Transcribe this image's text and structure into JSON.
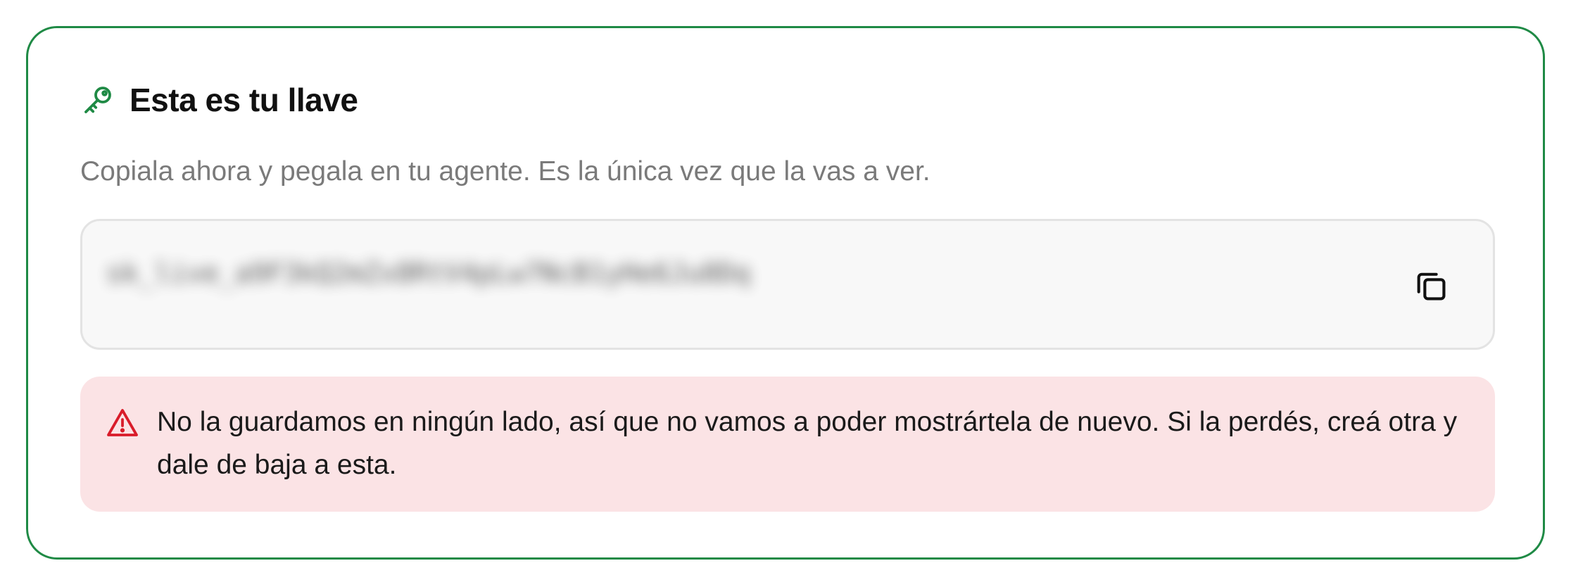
{
  "card": {
    "title": "Esta es tu llave",
    "subtitle": "Copiala ahora y pegala en tu agente. Es la única vez que la vas a ver.",
    "key_icon": "key-icon",
    "accent_color": "#1f8a45"
  },
  "key_field": {
    "value": "sk_live_a9F3kQ2mZx8RtV4pLw7NcB1yHe6Ju0Dq",
    "copy_icon": "copy-icon"
  },
  "warning": {
    "icon": "warning-triangle-icon",
    "text": "No la guardamos en ningún lado, así que no vamos a poder mostrártela de nuevo. Si la perdés, creá otra y dale de baja a esta.",
    "background_color": "#fbe3e5",
    "icon_color": "#d91c2a"
  }
}
